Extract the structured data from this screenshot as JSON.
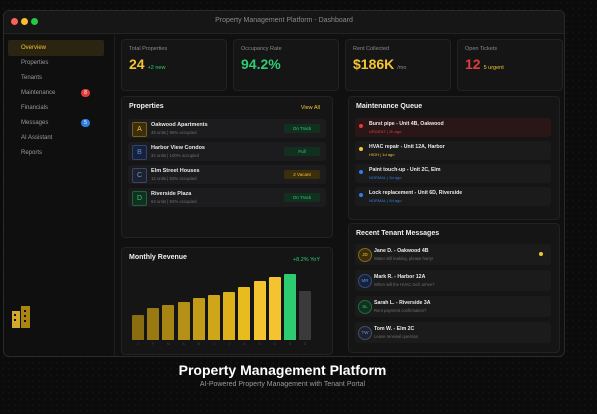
{
  "window": {
    "title": "Property Management Platform - Dashboard"
  },
  "sidebar": {
    "items": [
      {
        "label": "Overview",
        "active": true
      },
      {
        "label": "Properties"
      },
      {
        "label": "Tenants"
      },
      {
        "label": "Maintenance",
        "badge": "8",
        "badge_color": "#e23b3b"
      },
      {
        "label": "Financials"
      },
      {
        "label": "Messages",
        "badge": "5",
        "badge_color": "#2f7fe0"
      },
      {
        "label": "AI Assistant"
      },
      {
        "label": "Reports"
      }
    ]
  },
  "stats": [
    {
      "label": "Total Properties",
      "value": "24",
      "sub": "+2 new",
      "value_color": "#f4c430",
      "sub_color": "#2ecc71"
    },
    {
      "label": "Occupancy Rate",
      "value": "94.2%",
      "sub": "",
      "value_color": "#2ecc71",
      "sub_color": "#2ecc71"
    },
    {
      "label": "Rent Collected",
      "value": "$186K",
      "sub": "/mo",
      "value_color": "#f4c430",
      "sub_color": "#8a8a8a"
    },
    {
      "label": "Open Tickets",
      "value": "12",
      "sub": "5 urgent",
      "value_color": "#e23b3b",
      "sub_color": "#f4c430"
    }
  ],
  "properties": {
    "title": "Properties",
    "view_all": "View All",
    "items": [
      {
        "letter": "A",
        "name": "Oakwood Apartments",
        "meta": "48 units | 96% occupied",
        "status": "On Track",
        "letter_color": "#f4c430",
        "icon_bg": "#3a2e0c",
        "status_color": "#2ecc71",
        "status_bg": "#12301f"
      },
      {
        "letter": "B",
        "name": "Harbor View Condos",
        "meta": "32 units | 100% occupied",
        "status": "Full",
        "letter_color": "#5a8fe0",
        "icon_bg": "#17223a",
        "status_color": "#2ecc71",
        "status_bg": "#12301f"
      },
      {
        "letter": "C",
        "name": "Elm Street Houses",
        "meta": "12 units | 83% occupied",
        "status": "2 Vacant",
        "letter_color": "#7f8fc0",
        "icon_bg": "#1d2230",
        "status_color": "#f4c430",
        "status_bg": "#3a2e0c"
      },
      {
        "letter": "D",
        "name": "Riverside Plaza",
        "meta": "64 units | 92% occupied",
        "status": "On Track",
        "letter_color": "#2ecc71",
        "icon_bg": "#12301f",
        "status_color": "#2ecc71",
        "status_bg": "#12301f"
      }
    ]
  },
  "maintenance": {
    "title": "Maintenance Queue",
    "items": [
      {
        "title": "Burst pipe - Unit 4B, Oakwood",
        "tag": "URGENT | 2h ago",
        "dot_color": "#e23b3b",
        "tag_color": "#e23b3b",
        "bg": "#2a1616"
      },
      {
        "title": "HVAC repair - Unit 12A, Harbor",
        "tag": "HIGH | 1d ago",
        "dot_color": "#f4c430",
        "tag_color": "#f4c430",
        "bg": "#1b1b1c"
      },
      {
        "title": "Paint touch-up - Unit 2C, Elm",
        "tag": "NORMAL | 3d ago",
        "dot_color": "#2f7fe0",
        "tag_color": "#2f7fe0",
        "bg": "#1b1b1c"
      },
      {
        "title": "Lock replacement - Unit 6D, Riverside",
        "tag": "NORMAL | 5d ago",
        "dot_color": "#2f7fe0",
        "tag_color": "#2f7fe0",
        "bg": "#1b1b1c"
      }
    ]
  },
  "messages": {
    "title": "Recent Tenant Messages",
    "items": [
      {
        "initials": "JD",
        "name": "Jane D. - Oakwood 4B",
        "text": "Water still leaking, please hurry!",
        "avatar_color": "#f4c430",
        "avatar_bg": "#3a2e0c",
        "unread": true
      },
      {
        "initials": "MR",
        "name": "Mark R. - Harbor 12A",
        "text": "When will the HVAC tech arrive?",
        "avatar_color": "#5a8fe0",
        "avatar_bg": "#17223a",
        "unread": false
      },
      {
        "initials": "SL",
        "name": "Sarah L. - Riverside 3A",
        "text": "Rent payment confirmation?",
        "avatar_color": "#2ecc71",
        "avatar_bg": "#12301f",
        "unread": false
      },
      {
        "initials": "TW",
        "name": "Tom W. - Elm 2C",
        "text": "Lease renewal question",
        "avatar_color": "#7f8fc0",
        "avatar_bg": "#1d2230",
        "unread": false
      }
    ]
  },
  "chart_data": {
    "type": "bar",
    "title": "Monthly Revenue",
    "badge": "+8.2% YoY",
    "categories": [
      "J",
      "F",
      "M",
      "A",
      "M",
      "J",
      "J",
      "A",
      "S",
      "O",
      "N",
      "D"
    ],
    "values": [
      38,
      48,
      53,
      58,
      63,
      68,
      73,
      80,
      90,
      95,
      100,
      75
    ],
    "ylim": [
      0,
      100
    ],
    "colors": [
      "#8a6d10",
      "#997a12",
      "#a68514",
      "#b49016",
      "#c29b18",
      "#cfa61a",
      "#dcb11c",
      "#e8bb1e",
      "#f4c430",
      "#f4c430",
      "#2ecc71",
      "#3a3a3a"
    ]
  },
  "colors": {
    "accent": "#f4c430",
    "success": "#2ecc71",
    "danger": "#e23b3b",
    "info": "#2f7fe0"
  },
  "footer": {
    "title": "Property Management Platform",
    "subtitle": "AI-Powered Property Management with Tenant Portal"
  }
}
